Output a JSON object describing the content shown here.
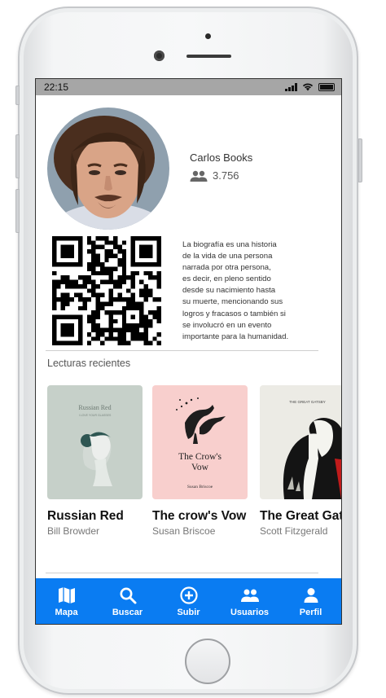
{
  "status_bar": {
    "time": "22:15"
  },
  "profile": {
    "name": "Carlos Books",
    "followers": "3.756",
    "bio_lines": [
      "La biografía es una historia",
      "de la vida de una persona",
      "narrada por otra persona,",
      "es decir, en pleno sentido",
      "desde su nacimiento hasta",
      "su muerte, mencionando sus",
      "logros y fracasos o también si",
      "se involucró en un evento",
      "importante para la humanidad."
    ]
  },
  "recent": {
    "title": "Lecturas recientes",
    "books": [
      {
        "title": "Russian Red",
        "author": "Bill Browder",
        "cover_title": "Russian Red",
        "cover_subtitle": "I LOVE YOUR GLASSES"
      },
      {
        "title": "The crow's Vow",
        "author": "Susan Briscoe",
        "cover_title_1": "The Crow's",
        "cover_title_2": "Vow",
        "cover_author": "Susan Briscoe"
      },
      {
        "title": "The Great Gatsby",
        "author": "Scott Fitzgerald",
        "cover_header": "THE GREAT GATSBY"
      }
    ]
  },
  "nav": {
    "items": [
      {
        "label": "Mapa",
        "icon": "map-icon"
      },
      {
        "label": "Buscar",
        "icon": "search-icon"
      },
      {
        "label": "Subir",
        "icon": "add-circle-icon"
      },
      {
        "label": "Usuarios",
        "icon": "users-icon"
      },
      {
        "label": "Perfil",
        "icon": "person-icon"
      }
    ]
  },
  "colors": {
    "nav_bar": "#0a7cf2",
    "status_bar": "#a6a6a6"
  }
}
